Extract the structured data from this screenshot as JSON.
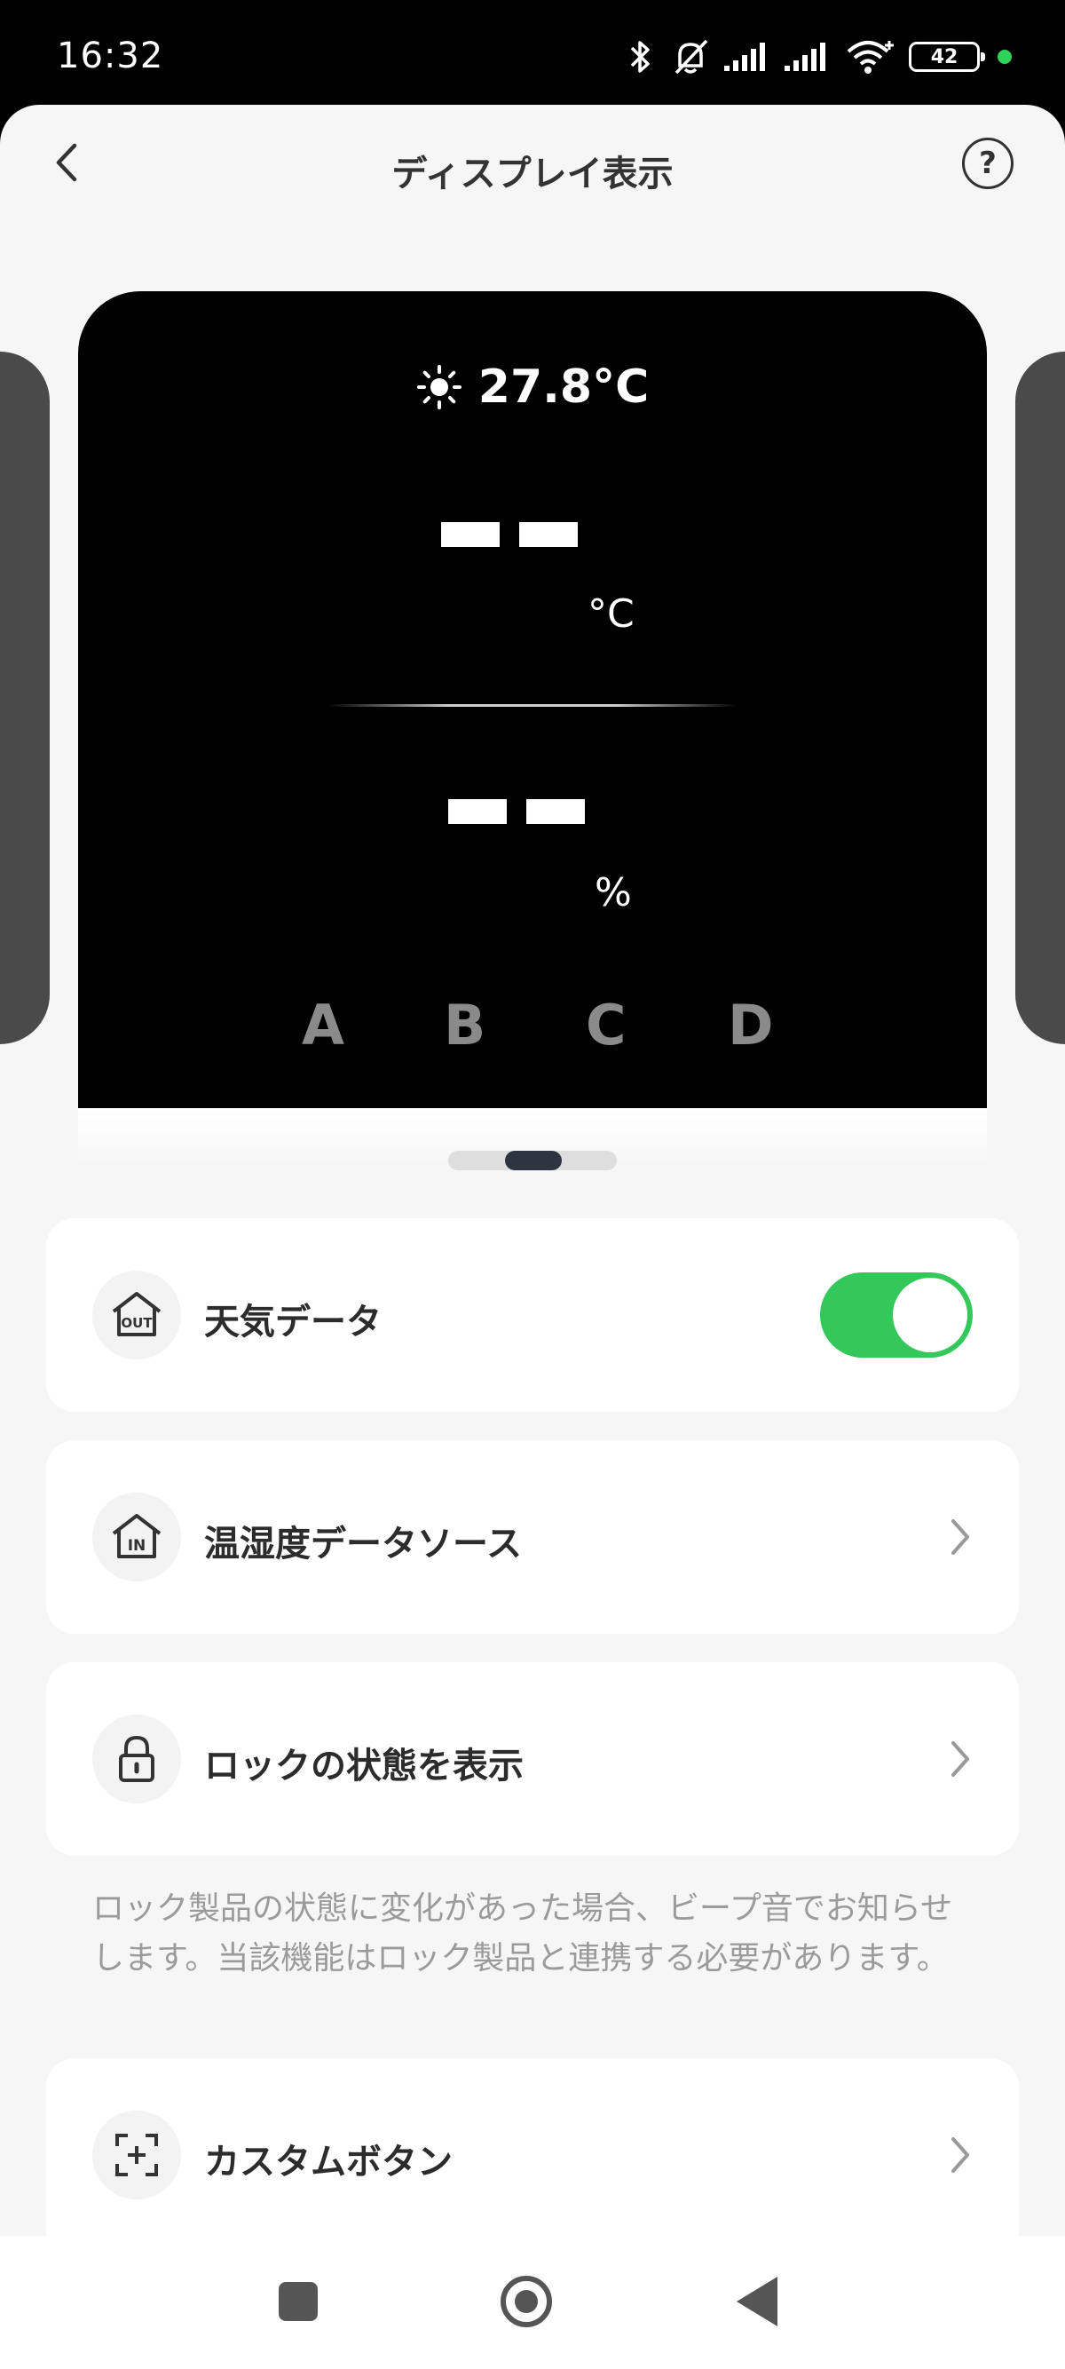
{
  "status_bar": {
    "time": "16:32",
    "battery": "42"
  },
  "header": {
    "title": "ディスプレイ表示",
    "back_icon": "chevron-left-icon",
    "help_icon": "help-circle-icon"
  },
  "preview": {
    "weather_icon": "sun-icon",
    "outdoor_temp": "27.8°C",
    "temp_unit": "°C",
    "humidity_unit": "%",
    "buttons": [
      "A",
      "B",
      "C",
      "D"
    ],
    "pager": {
      "pages": 3,
      "active": 2
    }
  },
  "settings": [
    {
      "icon": "home-out-icon",
      "label": "天気データ",
      "control": "toggle",
      "on": true
    },
    {
      "icon": "home-in-icon",
      "label": "温湿度データソース",
      "control": "chevron"
    },
    {
      "icon": "lock-icon",
      "label": "ロックの状態を表示",
      "control": "chevron"
    },
    {
      "icon": "custom-button-icon",
      "label": "カスタムボタン",
      "control": "chevron"
    }
  ],
  "lock_note": "ロック製品の状態に変化があった場合、ビープ音でお知らせします。当該機能はロック製品と連携する必要があります。",
  "colors": {
    "toggle_on": "#34c759",
    "display_bg": "#000000",
    "page_bg": "#f6f6f6"
  }
}
